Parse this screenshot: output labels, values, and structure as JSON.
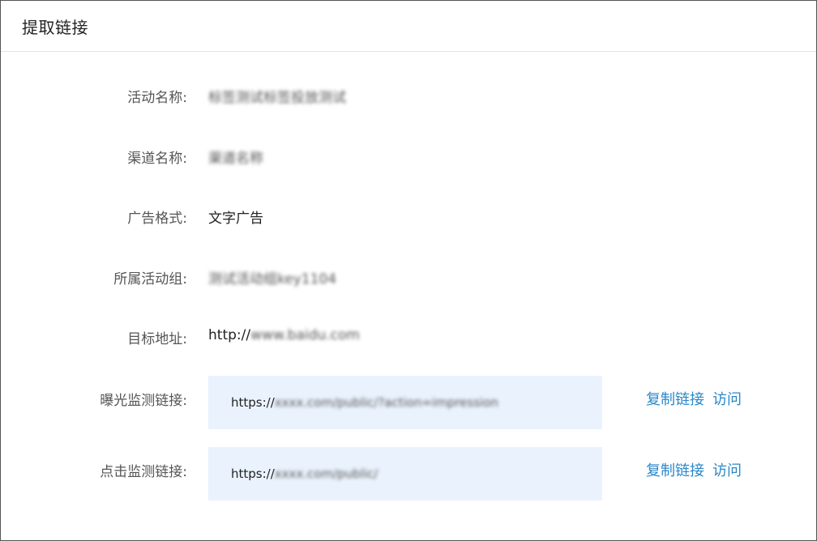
{
  "dialog": {
    "title": "提取链接"
  },
  "fields": {
    "activity_name": {
      "label": "活动名称:",
      "value": "标签测试标签投放测试"
    },
    "channel_name": {
      "label": "渠道名称:",
      "value": "渠道名称"
    },
    "ad_format": {
      "label": "广告格式:",
      "value": "文字广告"
    },
    "activity_group": {
      "label": "所属活动组:",
      "value": "测试活动组key1104"
    },
    "target_url": {
      "label": "目标地址:",
      "prefix": "http://",
      "value_rest": "www.baidu.com"
    }
  },
  "monitor_links": {
    "exposure": {
      "label": "曝光监测链接:",
      "prefix": "https://",
      "value_rest": "xxxx.com/public/?action=impression",
      "copy_label": "复制链接",
      "visit_label": "访问"
    },
    "click": {
      "label": "点击监测链接:",
      "prefix": "https://",
      "value_rest": "xxxx.com/public/",
      "copy_label": "复制链接",
      "visit_label": "访问"
    }
  },
  "colors": {
    "accent_link": "#2b87c8",
    "link_box_bg": "#eaf3fd"
  }
}
